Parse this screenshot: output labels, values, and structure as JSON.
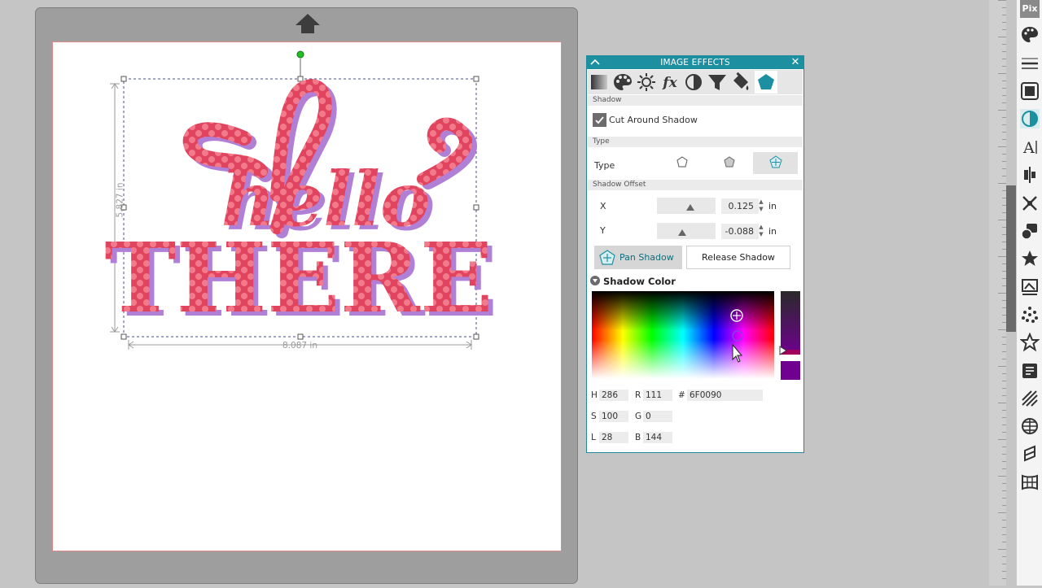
{
  "canvas": {
    "width_label": "8.087 in",
    "height_label": "5.827 in",
    "design": {
      "line1": "hello",
      "line2": "THERE",
      "fill_color": "#e0445e",
      "dot_color": "#f27a8a",
      "shadow_color": "#b07fd6"
    }
  },
  "image_effects": {
    "title": "IMAGE EFFECTS",
    "close_label": "✕",
    "tabs": [
      {
        "name": "gradient"
      },
      {
        "name": "palette"
      },
      {
        "name": "brightness"
      },
      {
        "name": "fx"
      },
      {
        "name": "contrast"
      },
      {
        "name": "filter"
      },
      {
        "name": "paint-bucket"
      },
      {
        "name": "shadow",
        "active": true
      }
    ],
    "shadow_section": "Shadow",
    "cut_around_shadow": {
      "label": "Cut Around Shadow",
      "checked": true
    },
    "type_section": "Type",
    "type_label": "Type",
    "type_options": [
      {
        "name": "outline-pentagon"
      },
      {
        "name": "filled-pentagon"
      },
      {
        "name": "pan-pentagon",
        "active": true
      }
    ],
    "offset_section": "Shadow Offset",
    "offset_x": {
      "label": "X",
      "value": "0.125",
      "unit": "in"
    },
    "offset_y": {
      "label": "Y",
      "value": "-0.088",
      "unit": "in"
    },
    "pan_shadow_label": "Pan Shadow",
    "release_shadow_label": "Release Shadow",
    "shadow_color_title": "Shadow Color",
    "color": {
      "hex_value": "6F0090",
      "swatch": "#6f0090",
      "h_label": "H",
      "h": "286",
      "s_label": "S",
      "s": "100",
      "l_label": "L",
      "l": "28",
      "r_label": "R",
      "r": "111",
      "g_label": "G",
      "g": "0",
      "b_label": "B",
      "b": "144",
      "hash_label": "#"
    }
  },
  "toolbar": {
    "top_label": "Pix",
    "accent": "#1c8fa0"
  }
}
